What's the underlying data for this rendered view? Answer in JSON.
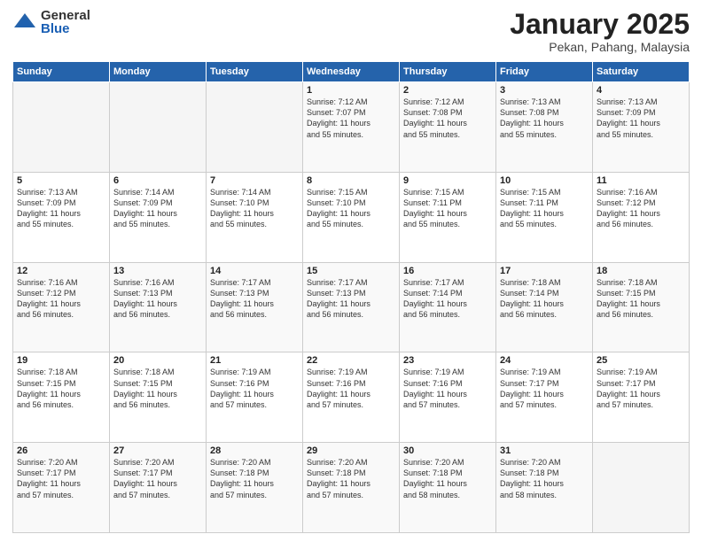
{
  "logo": {
    "general": "General",
    "blue": "Blue"
  },
  "header": {
    "title": "January 2025",
    "subtitle": "Pekan, Pahang, Malaysia"
  },
  "days_of_week": [
    "Sunday",
    "Monday",
    "Tuesday",
    "Wednesday",
    "Thursday",
    "Friday",
    "Saturday"
  ],
  "weeks": [
    [
      {
        "num": "",
        "info": ""
      },
      {
        "num": "",
        "info": ""
      },
      {
        "num": "",
        "info": ""
      },
      {
        "num": "1",
        "info": "Sunrise: 7:12 AM\nSunset: 7:07 PM\nDaylight: 11 hours\nand 55 minutes."
      },
      {
        "num": "2",
        "info": "Sunrise: 7:12 AM\nSunset: 7:08 PM\nDaylight: 11 hours\nand 55 minutes."
      },
      {
        "num": "3",
        "info": "Sunrise: 7:13 AM\nSunset: 7:08 PM\nDaylight: 11 hours\nand 55 minutes."
      },
      {
        "num": "4",
        "info": "Sunrise: 7:13 AM\nSunset: 7:09 PM\nDaylight: 11 hours\nand 55 minutes."
      }
    ],
    [
      {
        "num": "5",
        "info": "Sunrise: 7:13 AM\nSunset: 7:09 PM\nDaylight: 11 hours\nand 55 minutes."
      },
      {
        "num": "6",
        "info": "Sunrise: 7:14 AM\nSunset: 7:09 PM\nDaylight: 11 hours\nand 55 minutes."
      },
      {
        "num": "7",
        "info": "Sunrise: 7:14 AM\nSunset: 7:10 PM\nDaylight: 11 hours\nand 55 minutes."
      },
      {
        "num": "8",
        "info": "Sunrise: 7:15 AM\nSunset: 7:10 PM\nDaylight: 11 hours\nand 55 minutes."
      },
      {
        "num": "9",
        "info": "Sunrise: 7:15 AM\nSunset: 7:11 PM\nDaylight: 11 hours\nand 55 minutes."
      },
      {
        "num": "10",
        "info": "Sunrise: 7:15 AM\nSunset: 7:11 PM\nDaylight: 11 hours\nand 55 minutes."
      },
      {
        "num": "11",
        "info": "Sunrise: 7:16 AM\nSunset: 7:12 PM\nDaylight: 11 hours\nand 56 minutes."
      }
    ],
    [
      {
        "num": "12",
        "info": "Sunrise: 7:16 AM\nSunset: 7:12 PM\nDaylight: 11 hours\nand 56 minutes."
      },
      {
        "num": "13",
        "info": "Sunrise: 7:16 AM\nSunset: 7:13 PM\nDaylight: 11 hours\nand 56 minutes."
      },
      {
        "num": "14",
        "info": "Sunrise: 7:17 AM\nSunset: 7:13 PM\nDaylight: 11 hours\nand 56 minutes."
      },
      {
        "num": "15",
        "info": "Sunrise: 7:17 AM\nSunset: 7:13 PM\nDaylight: 11 hours\nand 56 minutes."
      },
      {
        "num": "16",
        "info": "Sunrise: 7:17 AM\nSunset: 7:14 PM\nDaylight: 11 hours\nand 56 minutes."
      },
      {
        "num": "17",
        "info": "Sunrise: 7:18 AM\nSunset: 7:14 PM\nDaylight: 11 hours\nand 56 minutes."
      },
      {
        "num": "18",
        "info": "Sunrise: 7:18 AM\nSunset: 7:15 PM\nDaylight: 11 hours\nand 56 minutes."
      }
    ],
    [
      {
        "num": "19",
        "info": "Sunrise: 7:18 AM\nSunset: 7:15 PM\nDaylight: 11 hours\nand 56 minutes."
      },
      {
        "num": "20",
        "info": "Sunrise: 7:18 AM\nSunset: 7:15 PM\nDaylight: 11 hours\nand 56 minutes."
      },
      {
        "num": "21",
        "info": "Sunrise: 7:19 AM\nSunset: 7:16 PM\nDaylight: 11 hours\nand 57 minutes."
      },
      {
        "num": "22",
        "info": "Sunrise: 7:19 AM\nSunset: 7:16 PM\nDaylight: 11 hours\nand 57 minutes."
      },
      {
        "num": "23",
        "info": "Sunrise: 7:19 AM\nSunset: 7:16 PM\nDaylight: 11 hours\nand 57 minutes."
      },
      {
        "num": "24",
        "info": "Sunrise: 7:19 AM\nSunset: 7:17 PM\nDaylight: 11 hours\nand 57 minutes."
      },
      {
        "num": "25",
        "info": "Sunrise: 7:19 AM\nSunset: 7:17 PM\nDaylight: 11 hours\nand 57 minutes."
      }
    ],
    [
      {
        "num": "26",
        "info": "Sunrise: 7:20 AM\nSunset: 7:17 PM\nDaylight: 11 hours\nand 57 minutes."
      },
      {
        "num": "27",
        "info": "Sunrise: 7:20 AM\nSunset: 7:17 PM\nDaylight: 11 hours\nand 57 minutes."
      },
      {
        "num": "28",
        "info": "Sunrise: 7:20 AM\nSunset: 7:18 PM\nDaylight: 11 hours\nand 57 minutes."
      },
      {
        "num": "29",
        "info": "Sunrise: 7:20 AM\nSunset: 7:18 PM\nDaylight: 11 hours\nand 57 minutes."
      },
      {
        "num": "30",
        "info": "Sunrise: 7:20 AM\nSunset: 7:18 PM\nDaylight: 11 hours\nand 58 minutes."
      },
      {
        "num": "31",
        "info": "Sunrise: 7:20 AM\nSunset: 7:18 PM\nDaylight: 11 hours\nand 58 minutes."
      },
      {
        "num": "",
        "info": ""
      }
    ]
  ]
}
